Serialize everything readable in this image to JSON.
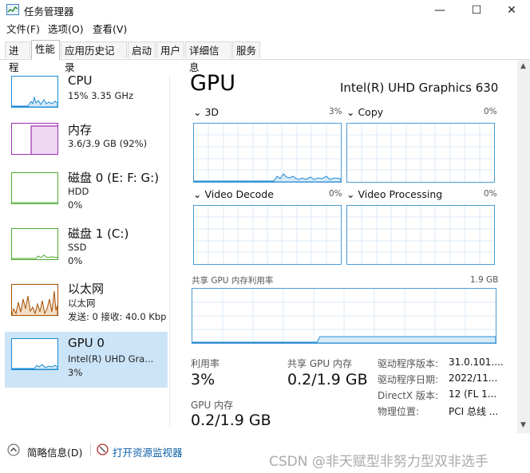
{
  "window": {
    "title": "任务管理器"
  },
  "menu": [
    "文件(F)",
    "选项(O)",
    "查看(V)"
  ],
  "tabs": [
    "进程",
    "性能",
    "应用历史记录",
    "启动",
    "用户",
    "详细信息",
    "服务"
  ],
  "sidebar": [
    {
      "name": "CPU",
      "line1": "15% 3.35 GHz",
      "line2": "",
      "line3": "",
      "color": "#1f8dd6"
    },
    {
      "name": "内存",
      "line1": "3.6/3.9 GB (92%)",
      "line2": "",
      "line3": "",
      "color": "#9c2fb0"
    },
    {
      "name": "磁盘 0 (E: F: G:)",
      "line1": "HDD",
      "line2": "0%",
      "line3": "",
      "color": "#4da82e"
    },
    {
      "name": "磁盘 1 (C:)",
      "line1": "SSD",
      "line2": "0%",
      "line3": "",
      "color": "#4da82e"
    },
    {
      "name": "以太网",
      "line1": "以太网",
      "line2": "发送: 0 接收: 40.0 Kbp",
      "line3": "",
      "color": "#a74f01"
    },
    {
      "name": "GPU 0",
      "line1": "Intel(R) UHD Gra...",
      "line2": "3%",
      "line3": "",
      "color": "#1f8dd6"
    }
  ],
  "main": {
    "title": "GPU",
    "model": "Intel(R) UHD Graphics 630",
    "graphs": [
      {
        "label": "3D",
        "pct": "3%"
      },
      {
        "label": "Copy",
        "pct": "0%"
      },
      {
        "label": "Video Decode",
        "pct": "0%"
      },
      {
        "label": "Video Processing",
        "pct": "0%"
      }
    ],
    "shared_mem_label": "共享 GPU 内存利用率",
    "shared_mem_max": "1.9 GB",
    "stats": {
      "util_label": "利用率",
      "util_value": "3%",
      "shared_label": "共享 GPU 内存",
      "shared_value": "0.2/1.9 GB",
      "gpumem_label": "GPU 内存",
      "gpumem_value": "0.2/1.9 GB"
    },
    "details": [
      {
        "key": "驱动程序版本:",
        "val": "31.0.101...."
      },
      {
        "key": "驱动程序日期:",
        "val": "2022/11..."
      },
      {
        "key": "DirectX 版本:",
        "val": "12 (FL 1..."
      },
      {
        "key": "物理位置:",
        "val": "PCI 总线 ..."
      }
    ]
  },
  "footer": {
    "summary_label": "简略信息(D)",
    "monitor_link": "打开资源监视器",
    "watermark": "CSDN @非天赋型非努力型双非选手"
  },
  "colors": {
    "accent": "#1f8dd6",
    "graph_border": "#4c9bd6",
    "selected": "#cce4f7"
  }
}
